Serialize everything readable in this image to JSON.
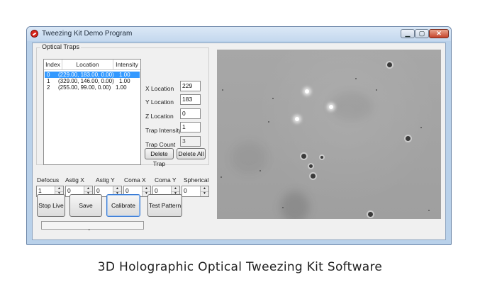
{
  "window": {
    "title": "Tweezing Kit Demo Program",
    "controls": {
      "minimize_icon": "minimize-icon",
      "maximize_icon": "maximize-icon",
      "close_icon": "close-icon"
    },
    "accent_close": "#c5432a"
  },
  "optical_traps": {
    "group_label": "Optical Traps",
    "columns": [
      "Index",
      "Location",
      "Intensity"
    ],
    "rows": [
      {
        "index": "0",
        "location": "(229.00, 183.00, 0.00)",
        "intensity": "1.00",
        "selected": true
      },
      {
        "index": "1",
        "location": "(329.00, 146.00, 0.00)",
        "intensity": "1.00",
        "selected": false
      },
      {
        "index": "2",
        "location": "(255.00, 99.00, 0.00)",
        "intensity": "1.00",
        "selected": false
      }
    ],
    "fields": {
      "x_label": "X Location",
      "x_value": "229",
      "y_label": "Y Location",
      "y_value": "183",
      "z_label": "Z Location",
      "z_value": "0",
      "intensity_label": "Trap Intensity",
      "intensity_value": "1",
      "count_label": "Trap Count",
      "count_value": "3"
    },
    "delete_trap": "Delete Trap",
    "delete_all": "Delete All"
  },
  "aberrations": [
    {
      "label": "Defocus",
      "value": "1"
    },
    {
      "label": "Astig X",
      "value": "0"
    },
    {
      "label": "Astig Y",
      "value": "0"
    },
    {
      "label": "Coma X",
      "value": "0"
    },
    {
      "label": "Coma Y",
      "value": "0"
    },
    {
      "label": "Spherical",
      "value": "0"
    }
  ],
  "actions": {
    "stop_live": "Stop Live",
    "save_image": "Save Image",
    "calibrate": "Calibrate",
    "test_pattern": "Test Pattern"
  },
  "caption": "3D Holographic Optical Tweezing Kit Software"
}
